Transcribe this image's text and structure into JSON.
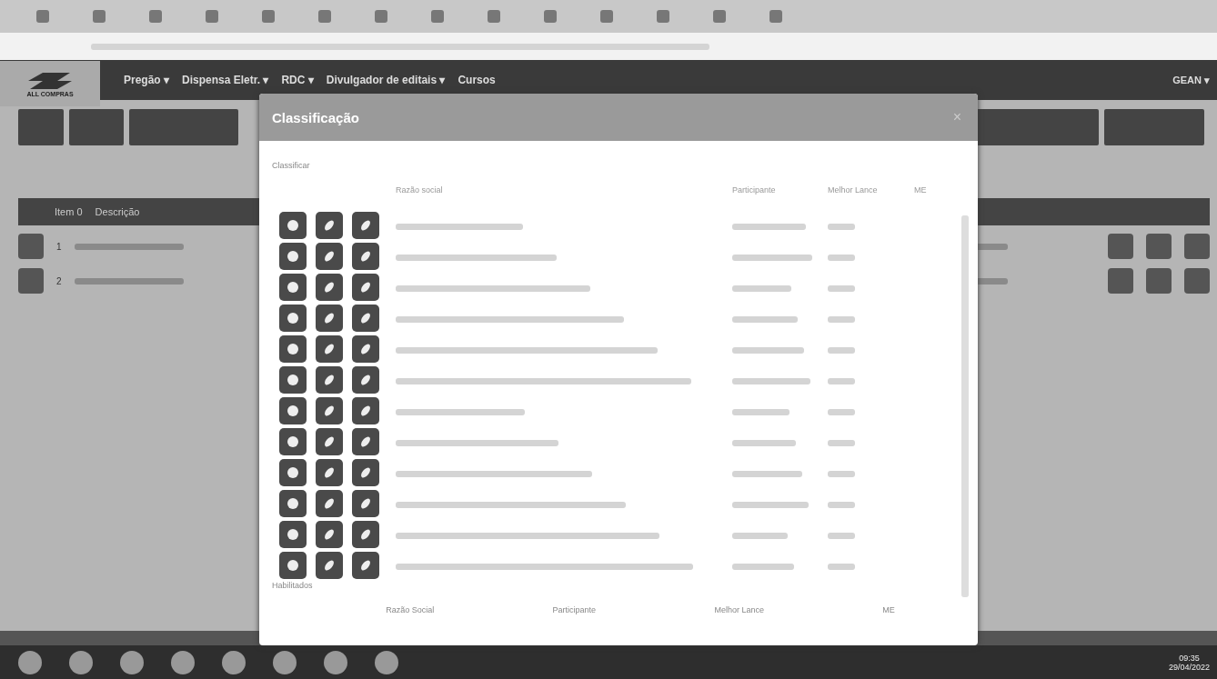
{
  "nav": {
    "logo": "ALL COMPRAS",
    "menu": [
      {
        "label": "Pregão ▾"
      },
      {
        "label": "Dispensa Eletr. ▾"
      },
      {
        "label": "RDC ▾"
      },
      {
        "label": "Divulgador de editais ▾"
      },
      {
        "label": "Cursos"
      }
    ],
    "user": "GEAN ▾"
  },
  "left_panel": {
    "columns": [
      "Item 0",
      "Descrição"
    ],
    "rows": [
      {
        "number": "1"
      },
      {
        "number": "2"
      }
    ]
  },
  "modal": {
    "title": "Classificação",
    "close": "×",
    "section_label": "Classificar",
    "columns": [
      "Razão social",
      "Participante",
      "Melhor Lance",
      "ME"
    ],
    "rows": [
      {
        "kind": "participant"
      },
      {
        "kind": "participant"
      },
      {
        "kind": "participant"
      },
      {
        "kind": "participant"
      },
      {
        "kind": "participant"
      },
      {
        "kind": "participant"
      },
      {
        "kind": "participant"
      },
      {
        "kind": "participant"
      },
      {
        "kind": "participant"
      },
      {
        "kind": "participant"
      },
      {
        "kind": "participant"
      },
      {
        "kind": "participant"
      }
    ],
    "footer_label": "Habilitados",
    "footer_columns": [
      "Razão Social",
      "Participante",
      "Melhor Lance",
      "ME"
    ]
  },
  "taskbar": {
    "time": "09:35",
    "date": "29/04/2022"
  }
}
